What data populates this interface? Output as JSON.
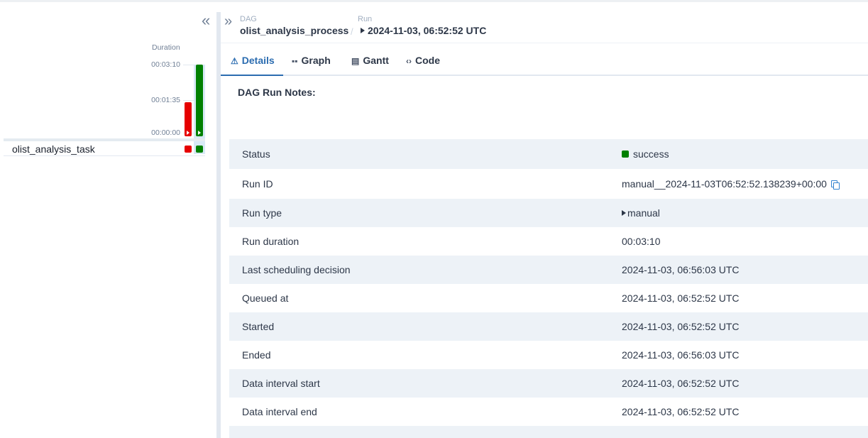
{
  "grid": {
    "duration_label": "Duration",
    "ticks": [
      "00:03:10",
      "00:01:35",
      "00:00:00"
    ],
    "max_seconds": 190,
    "runs": [
      {
        "duration_seconds": 90,
        "state": "failed",
        "color": "#e60000"
      },
      {
        "duration_seconds": 190,
        "state": "success",
        "color": "#008000",
        "selected": true
      }
    ],
    "task": {
      "name": "olist_analysis_task",
      "instances": [
        {
          "state": "failed",
          "color": "#e60000"
        },
        {
          "state": "success",
          "color": "#008000"
        }
      ]
    }
  },
  "breadcrumb": {
    "dag_label": "DAG",
    "dag_id": "olist_analysis_process",
    "separator": "/",
    "run_label": "Run",
    "run_value": "2024-11-03, 06:52:52 UTC"
  },
  "tabs": [
    {
      "label": "Details",
      "icon": "warning-triangle-icon",
      "active": true
    },
    {
      "label": "Graph",
      "icon": "graph-icon"
    },
    {
      "label": "Gantt",
      "icon": "gantt-icon"
    },
    {
      "label": "Code",
      "icon": "code-icon"
    }
  ],
  "details": {
    "notes_label": "DAG Run Notes:",
    "rows": [
      {
        "key": "Status",
        "value": "success"
      },
      {
        "key": "Run ID",
        "value": "manual__2024-11-03T06:52:52.138239+00:00"
      },
      {
        "key": "Run type",
        "value": "manual"
      },
      {
        "key": "Run duration",
        "value": "00:03:10"
      },
      {
        "key": "Last scheduling decision",
        "value": "2024-11-03, 06:56:03 UTC"
      },
      {
        "key": "Queued at",
        "value": "2024-11-03, 06:52:52 UTC"
      },
      {
        "key": "Started",
        "value": "2024-11-03, 06:52:52 UTC"
      },
      {
        "key": "Ended",
        "value": "2024-11-03, 06:56:03 UTC"
      },
      {
        "key": "Data interval start",
        "value": "2024-11-03, 06:52:52 UTC"
      },
      {
        "key": "Data interval end",
        "value": "2024-11-03, 06:52:52 UTC"
      }
    ]
  },
  "colors": {
    "success": "#008000",
    "failed": "#e60000",
    "accent": "#2b6cb0"
  }
}
